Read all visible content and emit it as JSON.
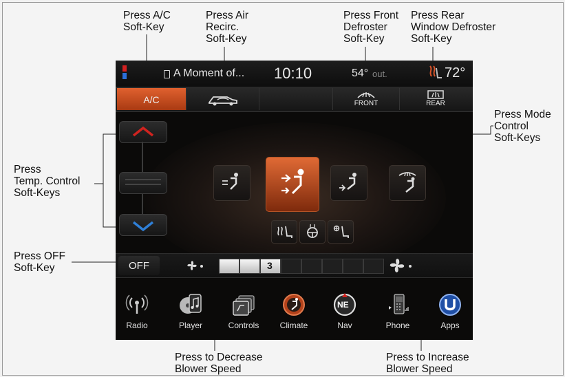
{
  "callouts": {
    "ac": "Press A/C\nSoft-Key",
    "recirc": "Press Air\nRecirc.\nSoft-Key",
    "front_defrost": "Press Front\nDefroster\nSoft-Key",
    "rear_defrost": "Press Rear\nWindow Defroster\nSoft-Key",
    "mode": "Press Mode\nControl\nSoft-Keys",
    "temp": "Press\nTemp. Control\nSoft-Keys",
    "off": "Press OFF\nSoft-Key",
    "decrease": "Press to Decrease\nBlower Speed",
    "increase": "Press to Increase\nBlower Speed"
  },
  "status_bar": {
    "media": "A Moment of...",
    "time": "10:10",
    "outside_temp": "54°",
    "outside_label": "out.",
    "set_temp": "72°"
  },
  "soft_keys": {
    "ac_label": "A/C",
    "front_label": "FRONT",
    "rear_label": "REAR"
  },
  "blower": {
    "off_label": "OFF",
    "level": "3",
    "segments_on": 3,
    "segments_total": 8
  },
  "nav": [
    {
      "label": "Radio",
      "icon": "radio-antenna-icon"
    },
    {
      "label": "Player",
      "icon": "media-player-icon"
    },
    {
      "label": "Controls",
      "icon": "controls-icon"
    },
    {
      "label": "Climate",
      "icon": "climate-icon"
    },
    {
      "label": "Nav",
      "icon": "compass-ne-icon",
      "badge": "NE"
    },
    {
      "label": "Phone",
      "icon": "phone-icon"
    },
    {
      "label": "Apps",
      "icon": "apps-icon"
    }
  ],
  "colors": {
    "accent": "#d9552a",
    "temp_up": "#d0231f",
    "temp_down": "#2f7fd6"
  }
}
